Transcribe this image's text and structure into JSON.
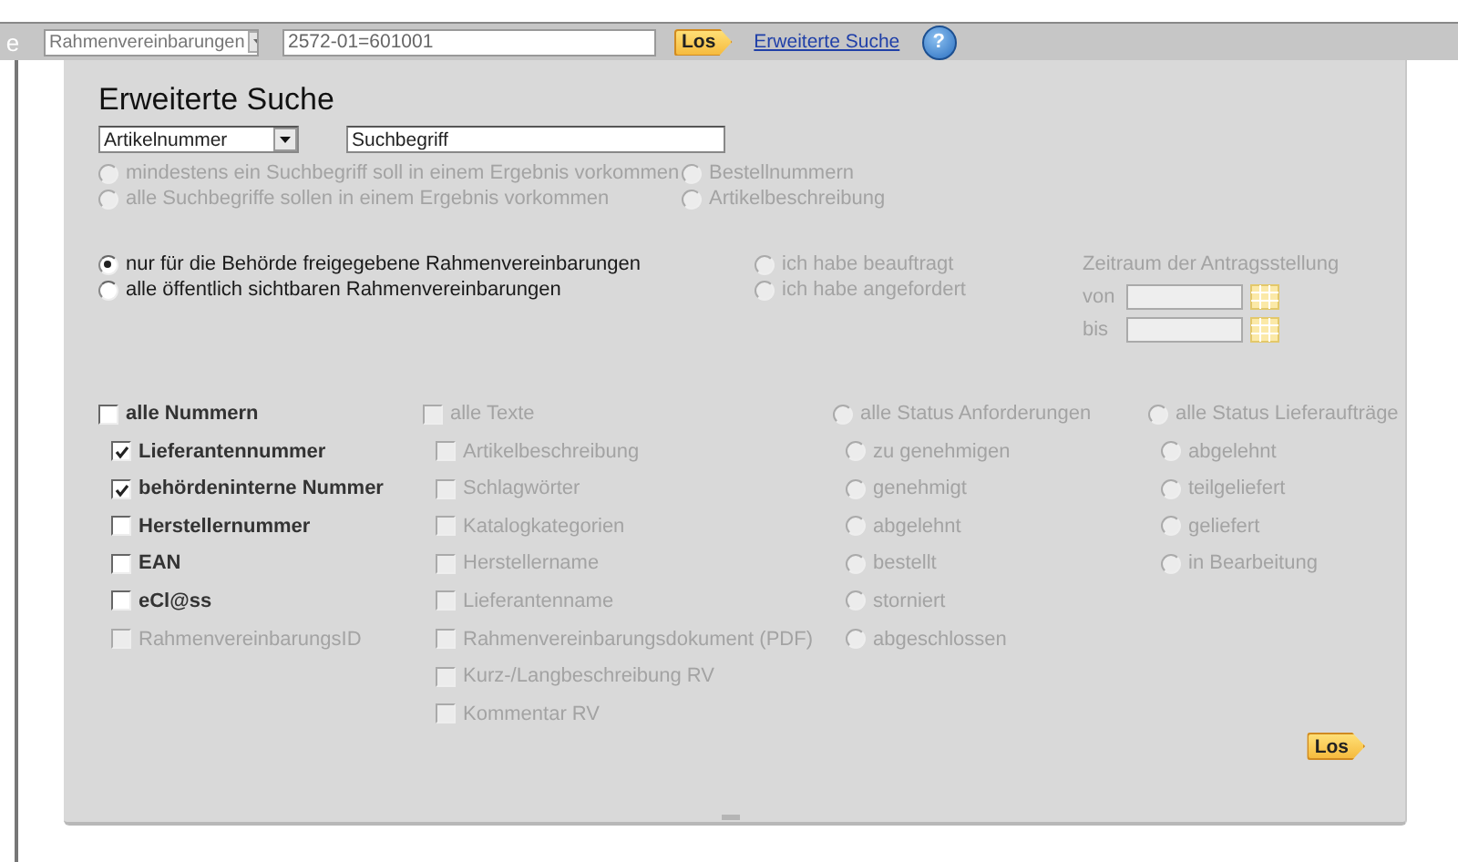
{
  "toolbar": {
    "logo": "e",
    "category_select": "Rahmenvereinbarungen",
    "query": "2572-01=601001",
    "go_button": "Los",
    "advanced_link": "Erweiterte Suche",
    "help_button": "?"
  },
  "search": {
    "title": "Erweiterte Suche",
    "field_select": "Artikelnummer",
    "term": "Suchbegriff",
    "match_options": [
      {
        "label": "mindestens ein Suchbegriff soll in einem Ergebnis vorkommen",
        "selected": false,
        "disabled": true
      },
      {
        "label": "alle Suchbegriffe sollen in einem Ergebnis vorkommen",
        "selected": false,
        "disabled": true
      }
    ],
    "scope_options": [
      {
        "label": "Bestellnummern",
        "selected": false,
        "disabled": true
      },
      {
        "label": "Artikelbeschreibung",
        "selected": false,
        "disabled": true
      }
    ]
  },
  "agreement_options": [
    {
      "label": "nur für die Behörde freigegebene Rahmenvereinbarungen",
      "selected": true,
      "disabled": false
    },
    {
      "label": "alle öffentlich sichtbaren Rahmenvereinbarungen",
      "selected": false,
      "disabled": false
    }
  ],
  "order_options": [
    {
      "label": "ich habe beauftragt",
      "selected": false,
      "disabled": true
    },
    {
      "label": "ich habe angefordert",
      "selected": false,
      "disabled": true
    }
  ],
  "period": {
    "label": "Zeitraum der Antragsstellung",
    "from_label": "von",
    "to_label": "bis",
    "disabled": true
  },
  "columns": [
    {
      "kind": "checkbox",
      "all": {
        "label": "alle Nummern",
        "checked": false,
        "disabled": false
      },
      "items": [
        {
          "label": "Lieferantennummer",
          "checked": true,
          "disabled": false
        },
        {
          "label": "behördeninterne Nummer",
          "checked": true,
          "disabled": false
        },
        {
          "label": "Herstellernummer",
          "checked": false,
          "disabled": false
        },
        {
          "label": "EAN",
          "checked": false,
          "disabled": false
        },
        {
          "label": "eCl@ss",
          "checked": false,
          "disabled": false
        },
        {
          "label": "RahmenvereinbarungsID",
          "checked": false,
          "disabled": true
        }
      ]
    },
    {
      "kind": "checkbox",
      "all": {
        "label": "alle Texte",
        "checked": false,
        "disabled": true
      },
      "items": [
        {
          "label": "Artikelbeschreibung",
          "checked": false,
          "disabled": true
        },
        {
          "label": "Schlagwörter",
          "checked": false,
          "disabled": true
        },
        {
          "label": "Katalogkategorien",
          "checked": false,
          "disabled": true
        },
        {
          "label": "Herstellername",
          "checked": false,
          "disabled": true
        },
        {
          "label": "Lieferantenname",
          "checked": false,
          "disabled": true
        },
        {
          "label": "Rahmenvereinbarungsdokument (PDF)",
          "checked": false,
          "disabled": true
        },
        {
          "label": "Kurz-/Langbeschreibung RV",
          "checked": false,
          "disabled": true
        },
        {
          "label": "Kommentar RV",
          "checked": false,
          "disabled": true
        }
      ]
    },
    {
      "kind": "radio",
      "all": {
        "label": "alle Status Anforderungen",
        "checked": false,
        "disabled": true
      },
      "items": [
        {
          "label": "zu genehmigen",
          "checked": false,
          "disabled": true
        },
        {
          "label": "genehmigt",
          "checked": false,
          "disabled": true
        },
        {
          "label": "abgelehnt",
          "checked": false,
          "disabled": true
        },
        {
          "label": "bestellt",
          "checked": false,
          "disabled": true
        },
        {
          "label": "storniert",
          "checked": false,
          "disabled": true
        },
        {
          "label": "abgeschlossen",
          "checked": false,
          "disabled": true
        }
      ]
    },
    {
      "kind": "radio",
      "all": {
        "label": "alle Status Lieferaufträge",
        "checked": false,
        "disabled": true
      },
      "items": [
        {
          "label": "abgelehnt",
          "checked": false,
          "disabled": true
        },
        {
          "label": "teilgeliefert",
          "checked": false,
          "disabled": true
        },
        {
          "label": "geliefert",
          "checked": false,
          "disabled": true
        },
        {
          "label": "in Bearbeitung",
          "checked": false,
          "disabled": true
        }
      ]
    }
  ],
  "submit_button": "Los"
}
